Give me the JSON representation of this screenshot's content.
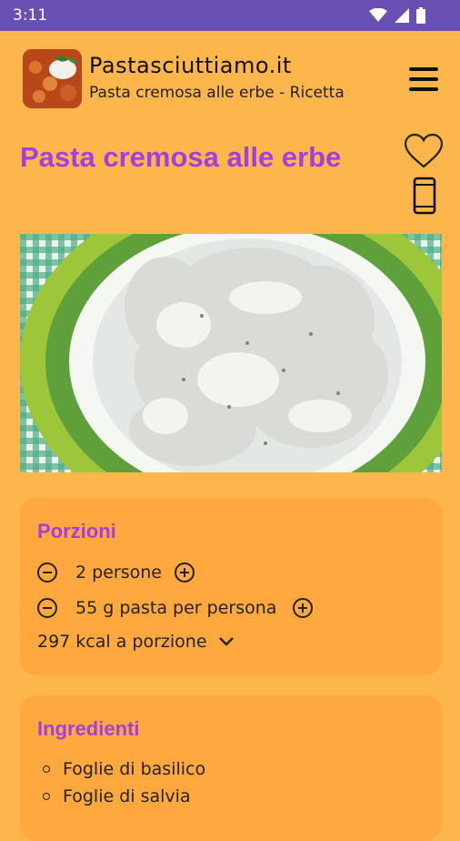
{
  "status_bar": {
    "time": "3:11",
    "icons": [
      "wifi-icon",
      "signal-icon",
      "battery-icon"
    ]
  },
  "header": {
    "app_title": "Pastasciuttiamo.it",
    "app_subtitle": "Pasta cremosa alle erbe - Ricetta",
    "menu_icon": "hamburger-menu-icon"
  },
  "recipe": {
    "title": "Pasta cremosa alle erbe",
    "favorite_icon": "heart-icon",
    "phone_icon": "smartphone-icon"
  },
  "portions": {
    "title": "Porzioni",
    "people": "2 persone",
    "pasta_per_person": "55 g pasta per persona",
    "calories": "297 kcal a porzione"
  },
  "ingredients": {
    "title": "Ingredienti",
    "items": [
      "Foglie di basilico",
      "Foglie di salvia"
    ]
  },
  "colors": {
    "background": "#FDB64B",
    "card": "#FEA83D",
    "accent": "#A33FE0",
    "status_bar": "#6A4FB3"
  }
}
